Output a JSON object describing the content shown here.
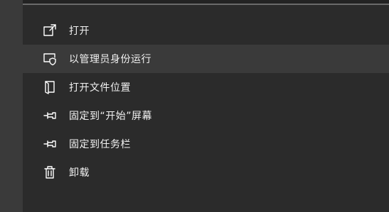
{
  "context_menu": {
    "items": [
      {
        "label": "打开",
        "icon": "open-external-icon"
      },
      {
        "label": "以管理员身份运行",
        "icon": "shield-window-icon"
      },
      {
        "label": "打开文件位置",
        "icon": "folder-open-icon"
      },
      {
        "label": "固定到“开始”屏幕",
        "icon": "pin-icon"
      },
      {
        "label": "固定到任务栏",
        "icon": "pin-icon"
      },
      {
        "label": "卸载",
        "icon": "trash-icon"
      }
    ]
  }
}
